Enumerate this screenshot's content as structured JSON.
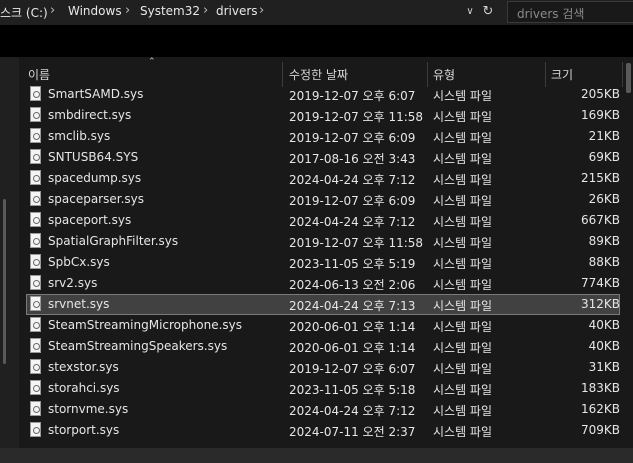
{
  "address_bar": {
    "breadcrumbs": [
      "스크 (C:)",
      "Windows",
      "System32",
      "drivers"
    ],
    "search_placeholder": "drivers 검색"
  },
  "columns": {
    "name": "이름",
    "date": "수정한 날짜",
    "type": "유형",
    "size": "크기"
  },
  "files": [
    {
      "name": "SmartSAMD.sys",
      "date": "2019-12-07 오후 6:07",
      "type": "시스템 파일",
      "size": "205KB"
    },
    {
      "name": "smbdirect.sys",
      "date": "2019-12-07 오후 11:58",
      "type": "시스템 파일",
      "size": "169KB"
    },
    {
      "name": "smclib.sys",
      "date": "2019-12-07 오후 6:09",
      "type": "시스템 파일",
      "size": "21KB"
    },
    {
      "name": "SNTUSB64.SYS",
      "date": "2017-08-16 오전 3:43",
      "type": "시스템 파일",
      "size": "69KB"
    },
    {
      "name": "spacedump.sys",
      "date": "2024-04-24 오후 7:12",
      "type": "시스템 파일",
      "size": "215KB"
    },
    {
      "name": "spaceparser.sys",
      "date": "2019-12-07 오후 6:09",
      "type": "시스템 파일",
      "size": "26KB"
    },
    {
      "name": "spaceport.sys",
      "date": "2024-04-24 오후 7:12",
      "type": "시스템 파일",
      "size": "667KB"
    },
    {
      "name": "SpatialGraphFilter.sys",
      "date": "2019-12-07 오후 11:58",
      "type": "시스템 파일",
      "size": "89KB"
    },
    {
      "name": "SpbCx.sys",
      "date": "2023-11-05 오후 5:19",
      "type": "시스템 파일",
      "size": "88KB"
    },
    {
      "name": "srv2.sys",
      "date": "2024-06-13 오전 2:06",
      "type": "시스템 파일",
      "size": "774KB"
    },
    {
      "name": "srvnet.sys",
      "date": "2024-04-24 오후 7:13",
      "type": "시스템 파일",
      "size": "312KB",
      "selected": true
    },
    {
      "name": "SteamStreamingMicrophone.sys",
      "date": "2020-06-01 오후 1:14",
      "type": "시스템 파일",
      "size": "40KB"
    },
    {
      "name": "SteamStreamingSpeakers.sys",
      "date": "2020-06-01 오후 1:14",
      "type": "시스템 파일",
      "size": "40KB"
    },
    {
      "name": "stexstor.sys",
      "date": "2019-12-07 오후 6:07",
      "type": "시스템 파일",
      "size": "31KB"
    },
    {
      "name": "storahci.sys",
      "date": "2023-11-05 오후 5:18",
      "type": "시스템 파일",
      "size": "183KB"
    },
    {
      "name": "stornvme.sys",
      "date": "2024-04-24 오후 7:12",
      "type": "시스템 파일",
      "size": "162KB"
    },
    {
      "name": "storport.sys",
      "date": "2024-07-11 오전 2:37",
      "type": "시스템 파일",
      "size": "709KB"
    }
  ],
  "colors": {
    "background": "#191919",
    "selected_row": "#414141",
    "text": "#e6e6e6"
  }
}
